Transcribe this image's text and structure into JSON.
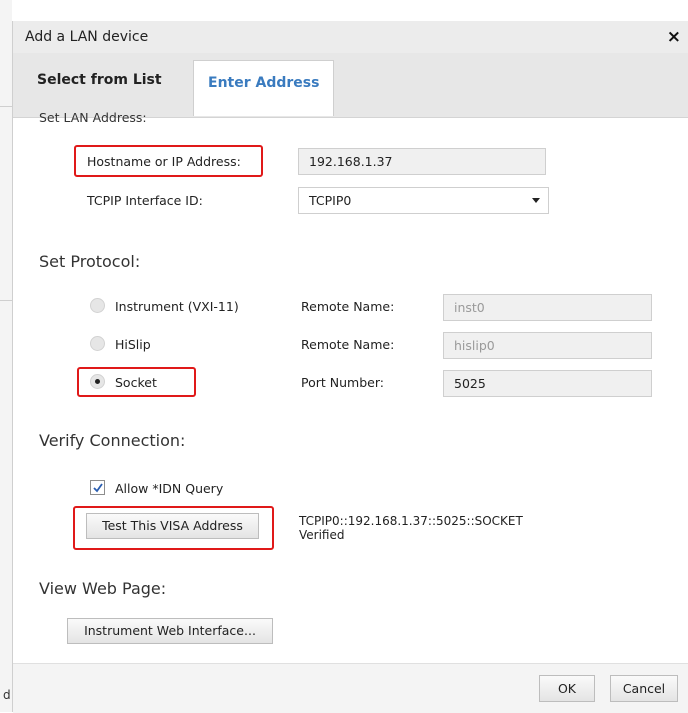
{
  "dialog": {
    "title": "Add a LAN device",
    "close_glyph": "×"
  },
  "tabs": [
    {
      "label": "Select from List",
      "active": false
    },
    {
      "label": "Enter Address",
      "active": true
    }
  ],
  "lan_address": {
    "heading": "Set LAN Address:",
    "hostname_label": "Hostname or IP Address:",
    "hostname_value": "192.168.1.37",
    "interface_label": "TCPIP Interface ID:",
    "interface_value": "TCPIP0"
  },
  "protocol": {
    "heading": "Set Protocol:",
    "options": [
      {
        "label": "Instrument (VXI-11)",
        "selected": false,
        "field_label": "Remote Name:",
        "field_value": "inst0",
        "editable": false
      },
      {
        "label": "HiSlip",
        "selected": false,
        "field_label": "Remote Name:",
        "field_value": "hislip0",
        "editable": false
      },
      {
        "label": "Socket",
        "selected": true,
        "field_label": "Port Number:",
        "field_value": "5025",
        "editable": true
      }
    ]
  },
  "verify": {
    "heading": "Verify Connection:",
    "allow_idn_label": "Allow *IDN Query",
    "allow_idn_checked": true,
    "test_button": "Test This VISA Address",
    "result_address": "TCPIP0::192.168.1.37::5025::SOCKET",
    "result_status": "Verified"
  },
  "web": {
    "heading": "View Web Page:",
    "button": "Instrument Web Interface..."
  },
  "footer": {
    "ok": "OK",
    "cancel": "Cancel"
  },
  "background": {
    "partial_letter": "d"
  },
  "colors": {
    "highlight": "#e01919",
    "active_tab_text": "#3a7bbf"
  }
}
